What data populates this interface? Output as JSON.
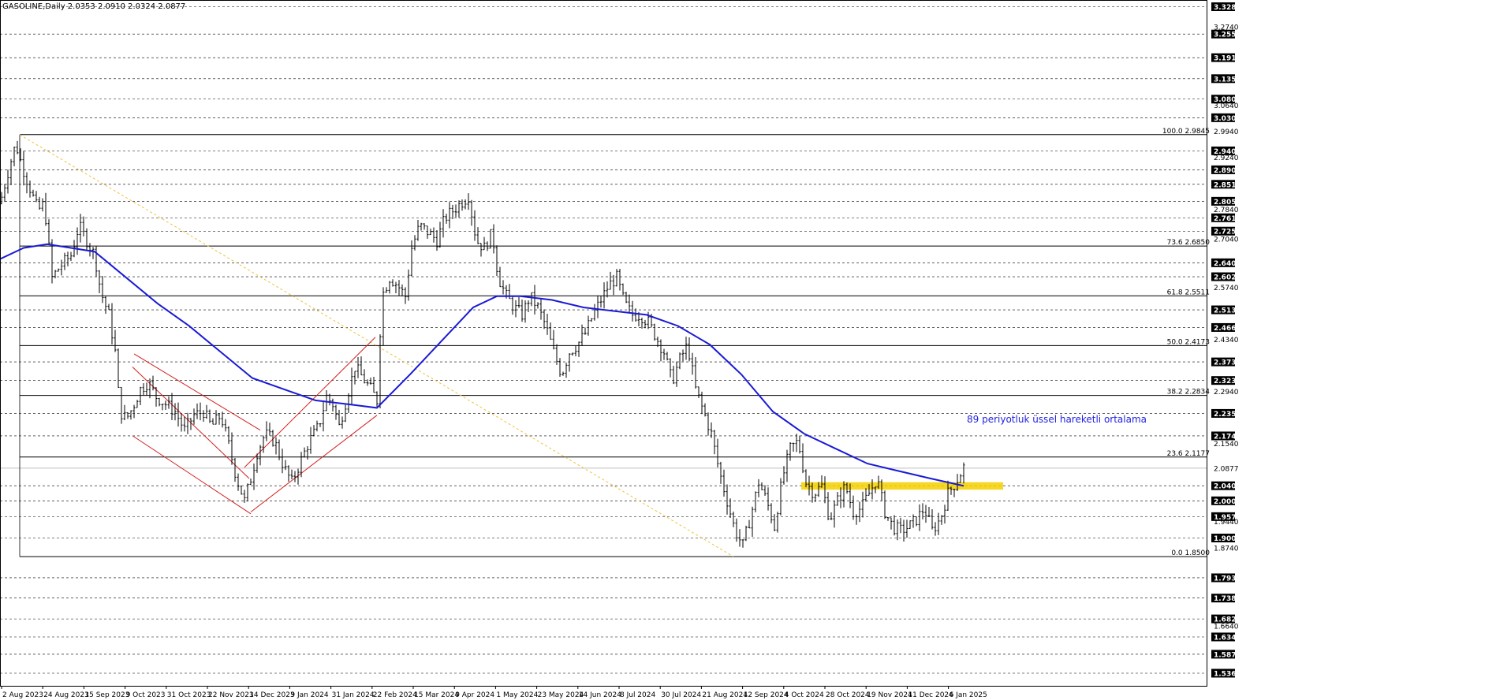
{
  "header": {
    "symbol_line": "GASOLINE,Daily  2.0353 2.0910 2.0324 2.0877"
  },
  "chart_data": {
    "type": "candlestick",
    "symbol": "GASOLINE",
    "timeframe": "Daily",
    "ohlc_last": {
      "open": 2.0353,
      "high": 2.091,
      "low": 2.0324,
      "close": 2.0877
    },
    "y_range": [
      1.53,
      3.33
    ],
    "current_price": "2.0877",
    "price_ticks": [
      "3.3285",
      "3.2740",
      "3.2550",
      "3.1915",
      "3.1350",
      "3.0800",
      "3.0640",
      "3.0300",
      "2.9940",
      "2.9409",
      "2.9240",
      "2.8900",
      "2.8510",
      "2.8053",
      "2.7840",
      "2.7610",
      "2.7250",
      "2.7040",
      "2.6400",
      "2.6025",
      "2.5740",
      "2.5135",
      "2.4660",
      "2.4340",
      "2.3735",
      "2.3235",
      "2.2940",
      "2.2350",
      "2.1745",
      "2.1540",
      "2.0877",
      "2.0405",
      "2.0000",
      "1.9575",
      "1.9440",
      "1.9000",
      "1.8740",
      "1.7930",
      "1.7385",
      "1.6825",
      "1.6640",
      "1.6340",
      "1.5875",
      "1.5365"
    ],
    "highlighted_ticks": [
      "3.3285",
      "3.2550",
      "3.1915",
      "3.1350",
      "3.0800",
      "3.0300",
      "2.9409",
      "2.8900",
      "2.8510",
      "2.8053",
      "2.7610",
      "2.7250",
      "2.6400",
      "2.6025",
      "2.5135",
      "2.4660",
      "2.3735",
      "2.3235",
      "2.2350",
      "2.1745",
      "2.0405",
      "2.0000",
      "1.9575",
      "1.9000",
      "1.7930",
      "1.7385",
      "1.6825",
      "1.6340",
      "1.5875",
      "1.5365"
    ],
    "date_labels": [
      "2 Aug 2023",
      "24 Aug 2023",
      "15 Sep 2023",
      "9 Oct 2023",
      "31 Oct 2023",
      "22 Nov 2023",
      "14 Dec 2023",
      "9 Jan 2024",
      "31 Jan 2024",
      "22 Feb 2024",
      "15 Mar 2024",
      "9 Apr 2024",
      "1 May 2024",
      "23 May 2024",
      "14 Jun 2024",
      "8 Jul 2024",
      "30 Jul 2024",
      "21 Aug 2024",
      "12 Sep 2024",
      "4 Oct 2024",
      "28 Oct 2024",
      "19 Nov 2024",
      "11 Dec 2024",
      "6 Jan 2025"
    ],
    "fibonacci_levels": [
      {
        "label": "100.0 2.9845",
        "value": 2.9845
      },
      {
        "label": "73.6 2.6850",
        "value": 2.685
      },
      {
        "label": "61.8 2.5511",
        "value": 2.5511
      },
      {
        "label": "50.0 2.4173",
        "value": 2.4173
      },
      {
        "label": "38.2 2.2834",
        "value": 2.2834
      },
      {
        "label": "23.6 2.1177",
        "value": 2.1177
      },
      {
        "label": "0.0 1.8500",
        "value": 1.85
      }
    ],
    "close_path": [
      [
        0,
        2.8
      ],
      [
        12,
        2.9
      ],
      [
        20,
        2.96
      ],
      [
        28,
        2.9
      ],
      [
        38,
        2.84
      ],
      [
        48,
        2.78
      ],
      [
        56,
        2.8
      ],
      [
        66,
        2.6
      ],
      [
        76,
        2.63
      ],
      [
        90,
        2.66
      ],
      [
        100,
        2.74
      ],
      [
        110,
        2.7
      ],
      [
        120,
        2.66
      ],
      [
        128,
        2.56
      ],
      [
        138,
        2.5
      ],
      [
        146,
        2.4
      ],
      [
        152,
        2.24
      ],
      [
        160,
        2.22
      ],
      [
        168,
        2.25
      ],
      [
        178,
        2.3
      ],
      [
        188,
        2.32
      ],
      [
        198,
        2.28
      ],
      [
        210,
        2.26
      ],
      [
        222,
        2.24
      ],
      [
        234,
        2.19
      ],
      [
        246,
        2.23
      ],
      [
        258,
        2.24
      ],
      [
        268,
        2.2
      ],
      [
        280,
        2.23
      ],
      [
        290,
        2.15
      ],
      [
        300,
        2.06
      ],
      [
        310,
        2.0
      ],
      [
        318,
        2.06
      ],
      [
        326,
        2.13
      ],
      [
        336,
        2.18
      ],
      [
        348,
        2.16
      ],
      [
        360,
        2.09
      ],
      [
        370,
        2.05
      ],
      [
        380,
        2.1
      ],
      [
        392,
        2.16
      ],
      [
        404,
        2.2
      ],
      [
        414,
        2.28
      ],
      [
        422,
        2.26
      ],
      [
        430,
        2.2
      ],
      [
        440,
        2.28
      ],
      [
        450,
        2.36
      ],
      [
        460,
        2.33
      ],
      [
        470,
        2.3
      ],
      [
        478,
        2.27
      ],
      [
        484,
        2.55
      ],
      [
        494,
        2.6
      ],
      [
        504,
        2.58
      ],
      [
        514,
        2.55
      ],
      [
        522,
        2.68
      ],
      [
        532,
        2.74
      ],
      [
        544,
        2.72
      ],
      [
        554,
        2.7
      ],
      [
        564,
        2.76
      ],
      [
        574,
        2.78
      ],
      [
        584,
        2.8
      ],
      [
        594,
        2.82
      ],
      [
        604,
        2.7
      ],
      [
        614,
        2.68
      ],
      [
        624,
        2.72
      ],
      [
        632,
        2.6
      ],
      [
        642,
        2.55
      ],
      [
        652,
        2.52
      ],
      [
        662,
        2.5
      ],
      [
        672,
        2.55
      ],
      [
        682,
        2.52
      ],
      [
        692,
        2.47
      ],
      [
        702,
        2.4
      ],
      [
        712,
        2.34
      ],
      [
        722,
        2.4
      ],
      [
        732,
        2.42
      ],
      [
        742,
        2.45
      ],
      [
        752,
        2.5
      ],
      [
        762,
        2.54
      ],
      [
        772,
        2.58
      ],
      [
        782,
        2.6
      ],
      [
        792,
        2.53
      ],
      [
        802,
        2.5
      ],
      [
        812,
        2.5
      ],
      [
        822,
        2.48
      ],
      [
        832,
        2.44
      ],
      [
        842,
        2.4
      ],
      [
        852,
        2.32
      ],
      [
        862,
        2.38
      ],
      [
        872,
        2.42
      ],
      [
        882,
        2.3
      ],
      [
        892,
        2.24
      ],
      [
        902,
        2.18
      ],
      [
        912,
        2.08
      ],
      [
        922,
        2.0
      ],
      [
        932,
        1.92
      ],
      [
        942,
        1.88
      ],
      [
        952,
        1.96
      ],
      [
        962,
        2.05
      ],
      [
        972,
        2.0
      ],
      [
        982,
        1.93
      ],
      [
        992,
        2.06
      ],
      [
        1002,
        2.14
      ],
      [
        1012,
        2.16
      ],
      [
        1022,
        2.05
      ],
      [
        1032,
        2.02
      ],
      [
        1042,
        2.04
      ],
      [
        1052,
        1.95
      ],
      [
        1062,
        2.0
      ],
      [
        1072,
        2.04
      ],
      [
        1082,
        1.97
      ],
      [
        1092,
        1.98
      ],
      [
        1102,
        2.02
      ],
      [
        1112,
        2.06
      ],
      [
        1122,
        1.97
      ],
      [
        1132,
        1.93
      ],
      [
        1142,
        1.92
      ],
      [
        1152,
        1.93
      ],
      [
        1162,
        1.95
      ],
      [
        1172,
        1.98
      ],
      [
        1182,
        1.92
      ],
      [
        1192,
        1.95
      ],
      [
        1202,
        2.02
      ],
      [
        1212,
        2.05
      ],
      [
        1222,
        2.09
      ]
    ],
    "ema_path": [
      [
        0,
        2.65
      ],
      [
        30,
        2.68
      ],
      [
        60,
        2.69
      ],
      [
        90,
        2.68
      ],
      [
        120,
        2.67
      ],
      [
        160,
        2.6
      ],
      [
        200,
        2.53
      ],
      [
        240,
        2.47
      ],
      [
        280,
        2.4
      ],
      [
        320,
        2.33
      ],
      [
        360,
        2.3
      ],
      [
        400,
        2.27
      ],
      [
        440,
        2.26
      ],
      [
        478,
        2.25
      ],
      [
        520,
        2.34
      ],
      [
        560,
        2.43
      ],
      [
        600,
        2.52
      ],
      [
        630,
        2.55
      ],
      [
        660,
        2.55
      ],
      [
        700,
        2.54
      ],
      [
        740,
        2.52
      ],
      [
        780,
        2.51
      ],
      [
        820,
        2.5
      ],
      [
        860,
        2.47
      ],
      [
        900,
        2.42
      ],
      [
        940,
        2.34
      ],
      [
        980,
        2.24
      ],
      [
        1020,
        2.18
      ],
      [
        1060,
        2.14
      ],
      [
        1100,
        2.1
      ],
      [
        1140,
        2.08
      ],
      [
        1180,
        2.06
      ],
      [
        1222,
        2.04
      ]
    ],
    "ema_annotation": "89 periyotluk üssel hareketli ortalama",
    "resistance_zone": [
      2.03,
      2.05
    ]
  }
}
